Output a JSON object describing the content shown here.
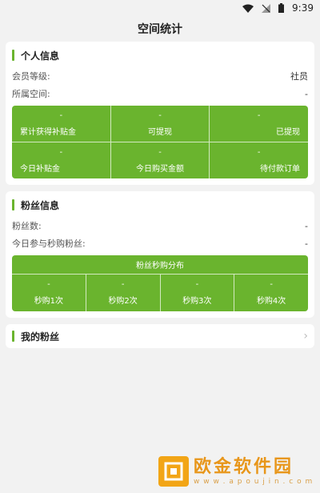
{
  "status_bar": {
    "time": "9:39"
  },
  "page": {
    "title": "空间统计"
  },
  "personal": {
    "title": "个人信息",
    "rows": [
      {
        "label": "会员等级:",
        "value": "社员"
      },
      {
        "label": "所属空间:",
        "value": "-"
      }
    ],
    "stats": [
      [
        {
          "value": "-",
          "label": "累计获得补贴金"
        },
        {
          "value": "-",
          "label": "可提现"
        },
        {
          "value": "-",
          "label": "已提现"
        }
      ],
      [
        {
          "value": "-",
          "label": "今日补贴金"
        },
        {
          "value": "-",
          "label": "今日购买金额"
        },
        {
          "value": "-",
          "label": "待付款订单"
        }
      ]
    ]
  },
  "fans": {
    "title": "粉丝信息",
    "rows": [
      {
        "label": "粉丝数:",
        "value": "-"
      },
      {
        "label": "今日参与秒购粉丝:",
        "value": "-"
      }
    ],
    "distribution_title": "粉丝秒购分布",
    "distribution": [
      {
        "value": "-",
        "label": "秒购1次"
      },
      {
        "value": "-",
        "label": "秒购2次"
      },
      {
        "value": "-",
        "label": "秒购3次"
      },
      {
        "value": "-",
        "label": "秒购4次"
      }
    ]
  },
  "my_fans": {
    "title": "我的粉丝"
  },
  "watermark": {
    "title": "欧金软件园",
    "sub": "w w w . a p o u j i n . c o m"
  },
  "colors": {
    "accent": "#6ab42e",
    "background": "#f2f2f2"
  }
}
